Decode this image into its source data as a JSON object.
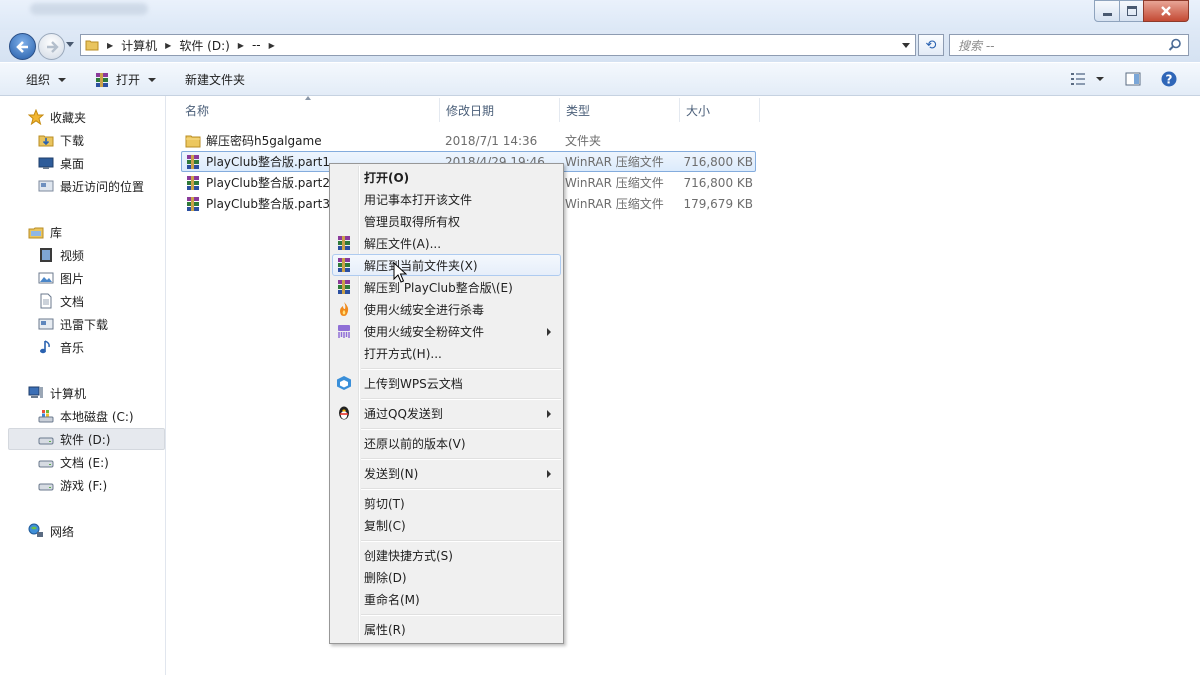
{
  "window": {
    "title": ""
  },
  "address": {
    "crumbs": [
      "计算机",
      "软件 (D:)",
      "--"
    ],
    "search_placeholder": "搜索 --"
  },
  "toolbar": {
    "organize": "组织",
    "open": "打开",
    "new_folder": "新建文件夹"
  },
  "nav": {
    "favorites": "收藏夹",
    "downloads": "下载",
    "desktop": "桌面",
    "recent": "最近访问的位置",
    "libraries": "库",
    "videos": "视频",
    "pictures": "图片",
    "documents": "文档",
    "thunder": "迅雷下载",
    "music": "音乐",
    "computer": "计算机",
    "drive_c": "本地磁盘 (C:)",
    "drive_d": "软件 (D:)",
    "drive_e": "文档 (E:)",
    "drive_f": "游戏 (F:)",
    "network": "网络"
  },
  "columns": {
    "name": "名称",
    "date": "修改日期",
    "type": "类型",
    "size": "大小"
  },
  "files": [
    {
      "name": "解压密码h5galgame",
      "date": "2018/7/1 14:36",
      "type": "文件夹",
      "size": "",
      "icon": "folder-icon"
    },
    {
      "name": "PlayClub整合版.part1",
      "date": "2018/4/29 19:46",
      "type": "WinRAR 压缩文件",
      "size": "716,800 KB",
      "icon": "winrar-icon"
    },
    {
      "name": "PlayClub整合版.part2",
      "date": "",
      "type": "WinRAR 压缩文件",
      "size": "716,800 KB",
      "icon": "winrar-icon"
    },
    {
      "name": "PlayClub整合版.part3",
      "date": "",
      "type": "WinRAR 压缩文件",
      "size": "179,679 KB",
      "icon": "winrar-icon"
    }
  ],
  "menu": {
    "open": "打开(O)",
    "open_notepad": "用记事本打开该文件",
    "take_ownership": "管理员取得所有权",
    "extract_files": "解压文件(A)...",
    "extract_here": "解压到当前文件夹(X)",
    "extract_to": "解压到 PlayClub整合版\\(E)",
    "huorong_scan": "使用火绒安全进行杀毒",
    "huorong_shred": "使用火绒安全粉碎文件",
    "open_with": "打开方式(H)...",
    "upload_wps": "上传到WPS云文档",
    "send_qq": "通过QQ发送到",
    "restore": "还原以前的版本(V)",
    "send_to": "发送到(N)",
    "cut": "剪切(T)",
    "copy": "复制(C)",
    "shortcut": "创建快捷方式(S)",
    "delete": "删除(D)",
    "rename": "重命名(M)",
    "properties": "属性(R)"
  },
  "colors": {
    "selection": "#dcebfc",
    "selection_border": "#84acdd",
    "menu_bg": "#f0f0f0",
    "accent": "#255da8"
  }
}
